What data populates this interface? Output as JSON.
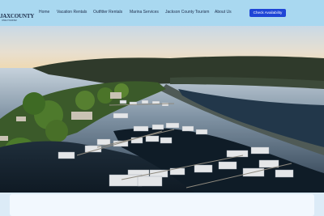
{
  "brand": {
    "name": "JAXCOUNTY",
    "tagline": "IOWA TOURISM"
  },
  "nav": {
    "items": [
      {
        "label": "Home"
      },
      {
        "label": "Vacation Rentals"
      },
      {
        "label": "Outfitter Rentals"
      },
      {
        "label": "Marina Services"
      },
      {
        "label": "Jackson County Tourism"
      },
      {
        "label": "About Us"
      }
    ],
    "cta_label": "Check Availability"
  },
  "hero": {
    "alt": "Aerial view of a marina with docked boats along a river at sunset"
  },
  "colors": {
    "navbar": "#a9d8f0",
    "cta": "#1f45d6",
    "page_bg": "#dcebf7"
  }
}
